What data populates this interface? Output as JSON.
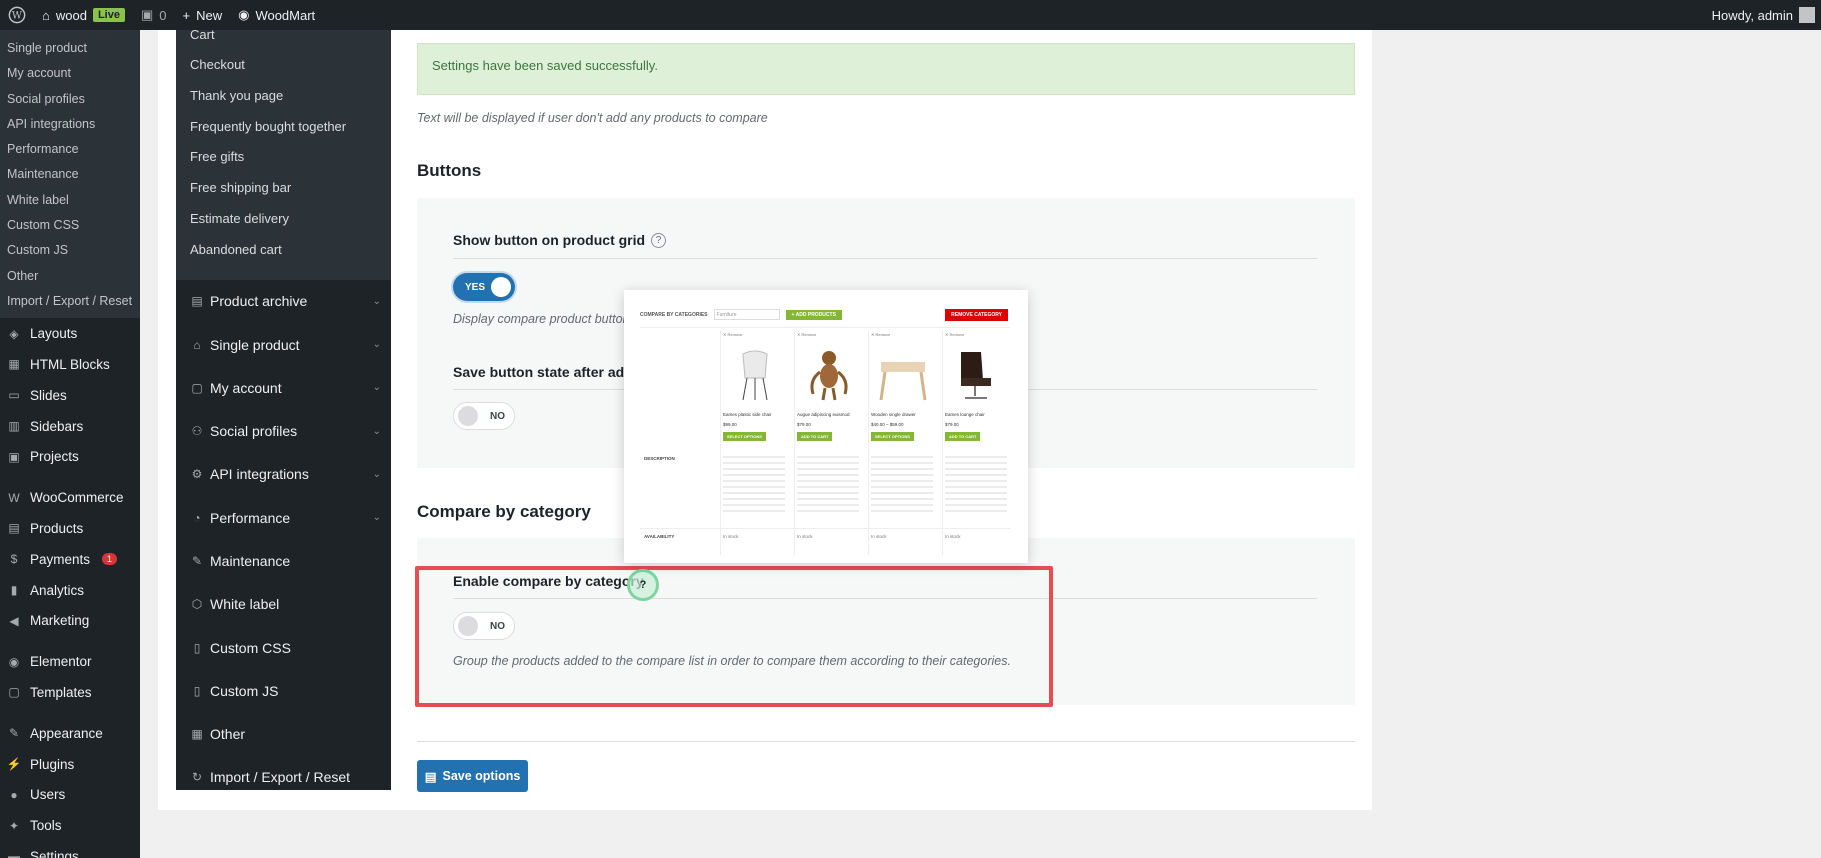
{
  "admin_bar": {
    "site_name": "wood",
    "live_badge": "Live",
    "comments_count": "0",
    "new_label": "New",
    "theme_label": "WoodMart",
    "greeting": "Howdy, admin"
  },
  "wp_sidebar": {
    "submenu": [
      "Single product",
      "My account",
      "Social profiles",
      "API integrations",
      "Performance",
      "Maintenance",
      "White label",
      "Custom CSS",
      "Custom JS",
      "Other",
      "Import / Export / Reset"
    ],
    "menu": [
      {
        "label": "Layouts",
        "icon": "layers-icon"
      },
      {
        "label": "HTML Blocks",
        "icon": "blocks-icon"
      },
      {
        "label": "Slides",
        "icon": "slides-icon"
      },
      {
        "label": "Sidebars",
        "icon": "sidebar-icon"
      },
      {
        "label": "Projects",
        "icon": "briefcase-icon"
      },
      {
        "label": "WooCommerce",
        "icon": "woo-icon"
      },
      {
        "label": "Products",
        "icon": "archive-icon"
      },
      {
        "label": "Payments",
        "icon": "payments-icon",
        "badge": "1"
      },
      {
        "label": "Analytics",
        "icon": "chart-icon"
      },
      {
        "label": "Marketing",
        "icon": "megaphone-icon"
      },
      {
        "label": "Elementor",
        "icon": "elementor-icon"
      },
      {
        "label": "Templates",
        "icon": "folder-icon"
      },
      {
        "label": "Appearance",
        "icon": "brush-icon"
      },
      {
        "label": "Plugins",
        "icon": "plug-icon"
      },
      {
        "label": "Users",
        "icon": "user-icon"
      },
      {
        "label": "Tools",
        "icon": "wrench-icon"
      },
      {
        "label": "Settings",
        "icon": "settings-icon"
      }
    ]
  },
  "settings_nav": {
    "subitems": [
      "Cart",
      "Checkout",
      "Thank you page",
      "Frequently bought together",
      "Free gifts",
      "Free shipping bar",
      "Estimate delivery",
      "Abandoned cart"
    ],
    "groups": [
      {
        "label": "Product archive",
        "expandable": true
      },
      {
        "label": "Single product",
        "expandable": true
      },
      {
        "label": "My account",
        "expandable": true
      },
      {
        "label": "Social profiles",
        "expandable": true
      },
      {
        "label": "API integrations",
        "expandable": true
      },
      {
        "label": "Performance",
        "expandable": true
      },
      {
        "label": "Maintenance",
        "expandable": false
      },
      {
        "label": "White label",
        "expandable": false
      },
      {
        "label": "Custom CSS",
        "expandable": false
      },
      {
        "label": "Custom JS",
        "expandable": false
      },
      {
        "label": "Other",
        "expandable": false
      },
      {
        "label": "Import / Export / Reset",
        "expandable": false
      }
    ]
  },
  "main": {
    "notice": "Settings have been saved successfully.",
    "empty_hint": "Text will be displayed if user don't add any products to compare",
    "buttons_section": {
      "title": "Buttons",
      "show_button_title": "Show button on product grid",
      "show_button_toggle": "YES",
      "show_button_desc": "Display compare product button",
      "save_state_title": "Save button state after addin",
      "save_state_toggle": "NO"
    },
    "compare_section": {
      "title": "Compare by category",
      "enable_title": "Enable compare by category",
      "enable_toggle": "NO",
      "enable_desc": "Group the products added to the compare list in order to compare them according to their categories."
    },
    "save_button": "Save options",
    "help_mark": "?"
  },
  "preview": {
    "categories_label": "COMPARE BY CATEGORIES",
    "input_placeholder": "Furniture",
    "add_products": "+ ADD PRODUCTS",
    "remove": "REMOVE CATEGORY",
    "row_description": "DESCRIPTION",
    "row_availability": "AVAILABILITY",
    "products": [
      {
        "remove": "✕ Remove",
        "name": "Eames plastic side chair",
        "price": "$99.00",
        "button": "SELECT OPTIONS",
        "stock": "In stock"
      },
      {
        "remove": "✕ Remove",
        "name": "Augue adipiscing euismod",
        "price": "$79.00",
        "button": "ADD TO CART",
        "stock": "In stock"
      },
      {
        "remove": "✕ Remove",
        "name": "Wooden single drawer",
        "price": "$40.00 – $59.00",
        "button": "SELECT OPTIONS",
        "stock": "In stock"
      },
      {
        "remove": "✕ Remove",
        "name": "Eames lounge chair",
        "price": "$79.00",
        "button": "ADD TO CART",
        "stock": "In stock"
      }
    ]
  }
}
